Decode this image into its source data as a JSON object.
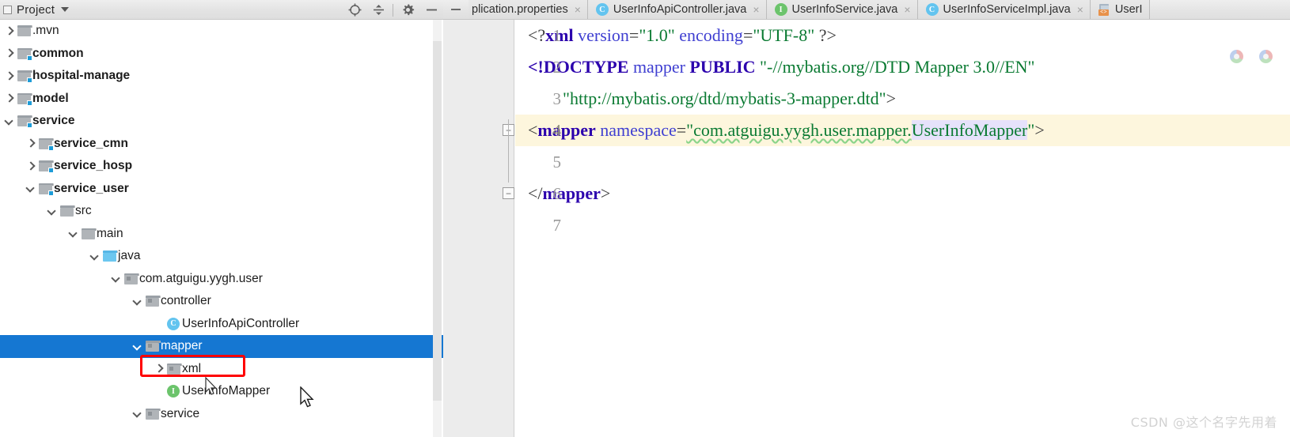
{
  "project_panel": {
    "title": "Project",
    "caret_icon": "chevron-down-icon",
    "tools": [
      {
        "name": "locate-icon",
        "label": "Select Opened File"
      },
      {
        "name": "collapse-all-icon",
        "label": "Collapse All"
      },
      {
        "name": "gear-icon",
        "label": "Settings"
      },
      {
        "name": "minimize-icon",
        "label": "Hide"
      }
    ],
    "tree": [
      {
        "label": ".mvn",
        "depth": 0,
        "arrow": "closed",
        "icon": "folder-plain",
        "bold": false,
        "selected": false
      },
      {
        "label": "common",
        "depth": 0,
        "arrow": "closed",
        "icon": "folder-module",
        "bold": true,
        "selected": false
      },
      {
        "label": "hospital-manage",
        "depth": 0,
        "arrow": "closed",
        "icon": "folder-module",
        "bold": true,
        "selected": false
      },
      {
        "label": "model",
        "depth": 0,
        "arrow": "closed",
        "icon": "folder-module",
        "bold": true,
        "selected": false
      },
      {
        "label": "service",
        "depth": 0,
        "arrow": "open",
        "icon": "folder-module",
        "bold": true,
        "selected": false
      },
      {
        "label": "service_cmn",
        "depth": 1,
        "arrow": "closed",
        "icon": "folder-module",
        "bold": true,
        "selected": false
      },
      {
        "label": "service_hosp",
        "depth": 1,
        "arrow": "closed",
        "icon": "folder-module",
        "bold": true,
        "selected": false
      },
      {
        "label": "service_user",
        "depth": 1,
        "arrow": "open",
        "icon": "folder-module",
        "bold": true,
        "selected": false
      },
      {
        "label": "src",
        "depth": 2,
        "arrow": "open",
        "icon": "folder-plain",
        "bold": false,
        "selected": false
      },
      {
        "label": "main",
        "depth": 3,
        "arrow": "open",
        "icon": "folder-plain",
        "bold": false,
        "selected": false
      },
      {
        "label": "java",
        "depth": 4,
        "arrow": "open",
        "icon": "folder-source",
        "bold": false,
        "selected": false
      },
      {
        "label": "com.atguigu.yygh.user",
        "depth": 5,
        "arrow": "open",
        "icon": "folder-package",
        "bold": false,
        "selected": false
      },
      {
        "label": "controller",
        "depth": 6,
        "arrow": "open",
        "icon": "folder-package",
        "bold": false,
        "selected": false
      },
      {
        "label": "UserInfoApiController",
        "depth": 7,
        "arrow": "none",
        "icon": "class-icon",
        "bold": false,
        "selected": false
      },
      {
        "label": "mapper",
        "depth": 6,
        "arrow": "open",
        "icon": "folder-package",
        "bold": false,
        "selected": true
      },
      {
        "label": "xml",
        "depth": 7,
        "arrow": "closed",
        "icon": "folder-package",
        "bold": false,
        "selected": false
      },
      {
        "label": "UserInfoMapper",
        "depth": 7,
        "arrow": "none",
        "icon": "interface-icon",
        "bold": false,
        "selected": false
      },
      {
        "label": "service",
        "depth": 6,
        "arrow": "open",
        "icon": "folder-package",
        "bold": false,
        "selected": false
      }
    ],
    "highlight_box_target": "xml"
  },
  "editor": {
    "tabs": [
      {
        "label": "plication.properties",
        "icon": "properties-icon",
        "truncated": true,
        "active": false,
        "close": "×"
      },
      {
        "label": "UserInfoApiController.java",
        "icon": "class-icon",
        "truncated": false,
        "active": false,
        "close": "×"
      },
      {
        "label": "UserInfoService.java",
        "icon": "interface-icon",
        "truncated": false,
        "active": false,
        "close": "×"
      },
      {
        "label": "UserInfoServiceImpl.java",
        "icon": "class-icon",
        "truncated": false,
        "active": false,
        "close": "×"
      },
      {
        "label": "UserI",
        "icon": "xml-file-icon",
        "truncated": true,
        "active": true,
        "close": ""
      }
    ],
    "line_numbers": [
      "1",
      "2",
      "3",
      "4",
      "5",
      "6",
      "7"
    ],
    "current_line": 4,
    "lines": [
      {
        "n": "1",
        "tokens": [
          {
            "t": "<?",
            "c": "punct"
          },
          {
            "t": "xml",
            "c": "tag"
          },
          {
            "t": " ",
            "c": "plain"
          },
          {
            "t": "version",
            "c": "attr"
          },
          {
            "t": "=",
            "c": "punct"
          },
          {
            "t": "\"1.0\"",
            "c": "val"
          },
          {
            "t": " ",
            "c": "plain"
          },
          {
            "t": "encoding",
            "c": "attr"
          },
          {
            "t": "=",
            "c": "punct"
          },
          {
            "t": "\"UTF-8\"",
            "c": "val"
          },
          {
            "t": " ",
            "c": "plain"
          },
          {
            "t": "?>",
            "c": "punct"
          }
        ]
      },
      {
        "n": "2",
        "tokens": [
          {
            "t": "<!DOCTYPE",
            "c": "tag"
          },
          {
            "t": " ",
            "c": "plain"
          },
          {
            "t": "mapper",
            "c": "attr"
          },
          {
            "t": " ",
            "c": "plain"
          },
          {
            "t": "PUBLIC",
            "c": "tag"
          },
          {
            "t": " ",
            "c": "plain"
          },
          {
            "t": "\"-//mybatis.org//DTD Mapper 3.0//EN\"",
            "c": "val"
          }
        ]
      },
      {
        "n": "3",
        "tokens": [
          {
            "t": "        ",
            "c": "plain"
          },
          {
            "t": "\"http://mybatis.org/dtd/mybatis-3-mapper.dtd\"",
            "c": "val"
          },
          {
            "t": ">",
            "c": "punct"
          }
        ]
      },
      {
        "n": "4",
        "tokens": [
          {
            "t": "<",
            "c": "punct"
          },
          {
            "t": "mapper",
            "c": "tag"
          },
          {
            "t": " ",
            "c": "plain"
          },
          {
            "t": "namespace",
            "c": "attr"
          },
          {
            "t": "=",
            "c": "punct"
          },
          {
            "t": "\"com.atguigu.yygh.user.mapper.",
            "c": "val-wavy"
          },
          {
            "t": "UserInfoMapper",
            "c": "val-hl"
          },
          {
            "t": "\"",
            "c": "val"
          },
          {
            "t": ">",
            "c": "punct"
          }
        ]
      },
      {
        "n": "5",
        "tokens": []
      },
      {
        "n": "6",
        "tokens": [
          {
            "t": "</",
            "c": "punct"
          },
          {
            "t": "mapper",
            "c": "tag"
          },
          {
            "t": ">",
            "c": "punct"
          }
        ]
      },
      {
        "n": "7",
        "tokens": []
      }
    ],
    "fold_markers": [
      {
        "line": 4,
        "glyph": "−"
      },
      {
        "line": 6,
        "glyph": "−"
      }
    ],
    "right_icons": [
      {
        "name": "browser-chrome-icon"
      },
      {
        "name": "browser-other-icon"
      }
    ]
  },
  "watermark": {
    "text": "CSDN @这个名字先用着"
  },
  "colors": {
    "selection_blue": "#1577d2",
    "highlight_red": "#ff0000",
    "current_line": "#fdf6dd",
    "tag": "#2b00ad",
    "attr": "#3f3fd1",
    "value": "#0a7a32"
  }
}
